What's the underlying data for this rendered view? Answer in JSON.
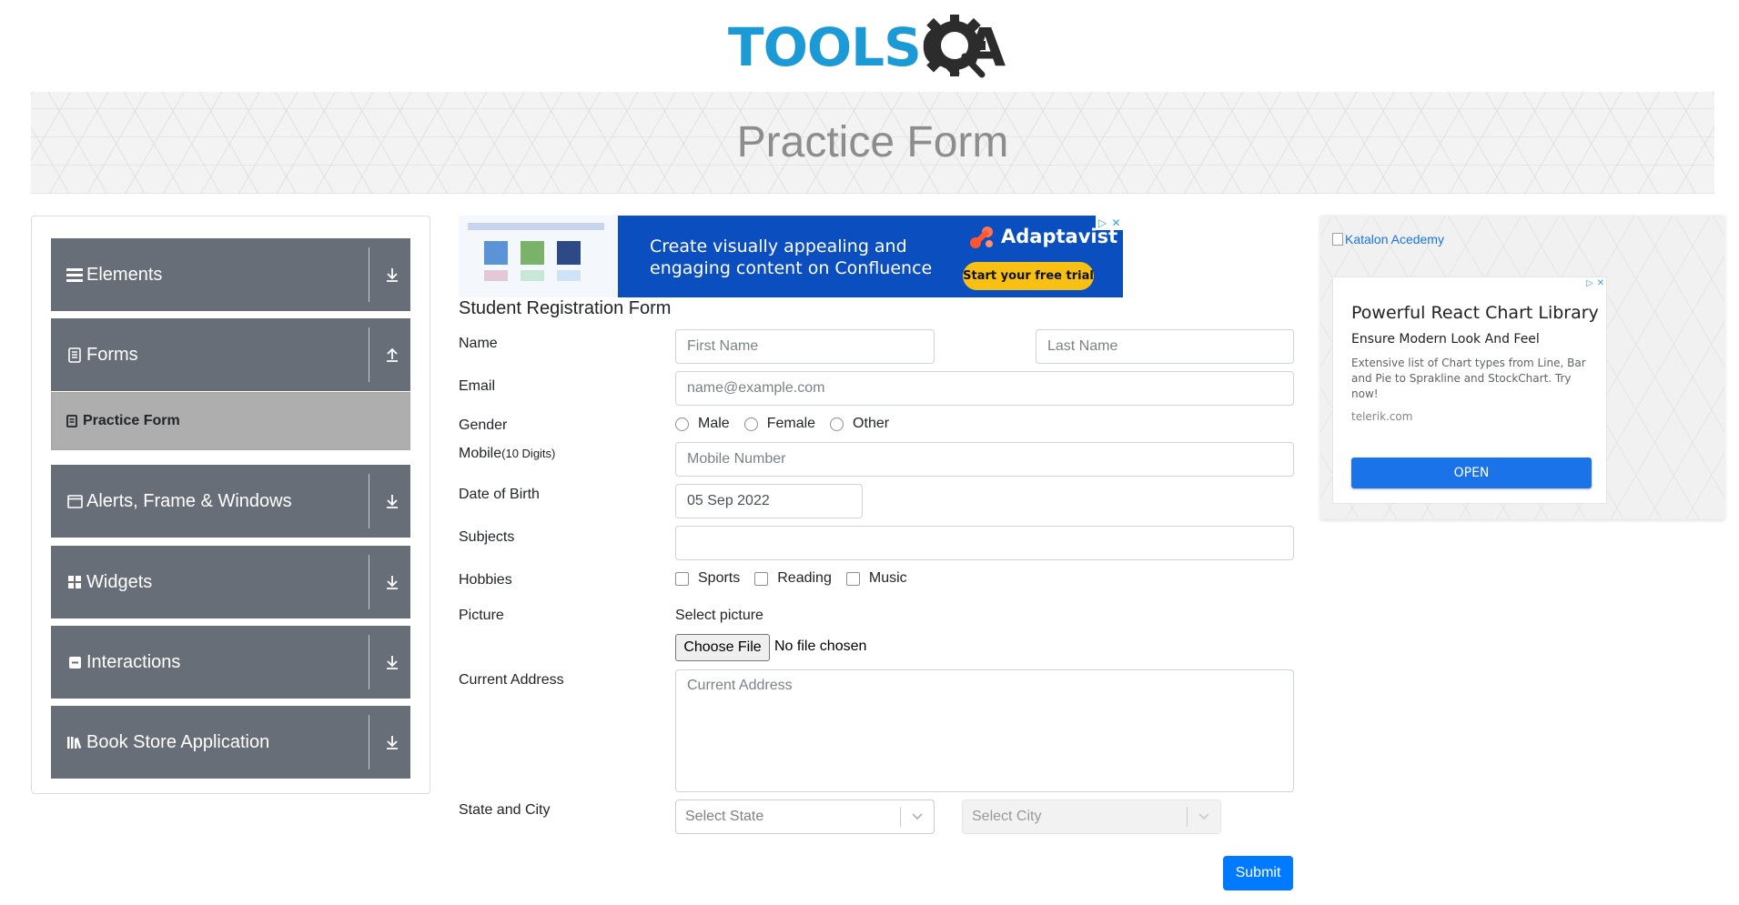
{
  "logo": {
    "text_main": "TOOLS",
    "text_accent": "QA",
    "colors": {
      "main": "#1b9ad6",
      "accent": "#2c2c2c"
    }
  },
  "page_title": "Practice Form",
  "sidebar": {
    "groups": [
      {
        "label": "Elements",
        "icon": "hamburger-icon",
        "arrow": "download-arrow-icon"
      },
      {
        "label": "Forms",
        "icon": "document-icon",
        "arrow": "upload-arrow-icon"
      },
      {
        "label": "Alerts, Frame & Windows",
        "icon": "window-icon",
        "arrow": "download-arrow-icon"
      },
      {
        "label": "Widgets",
        "icon": "grid-icon",
        "arrow": "download-arrow-icon"
      },
      {
        "label": "Interactions",
        "icon": "checkbox-icon",
        "arrow": "download-arrow-icon"
      },
      {
        "label": "Book Store Application",
        "icon": "books-icon",
        "arrow": "download-arrow-icon"
      }
    ],
    "active_item": {
      "label": "Practice Form",
      "icon": "form-icon"
    }
  },
  "ad_top": {
    "headline": "Create visually appealing and engaging content on Confluence",
    "brand": "Adaptavist",
    "cta": "Start your free trial",
    "colors": {
      "background": "#0a4ebf",
      "cta": "#f7c012",
      "brand_mark": "#ff5630"
    }
  },
  "form": {
    "title": "Student Registration Form",
    "name_label": "Name",
    "first_name_placeholder": "First Name",
    "last_name_placeholder": "Last Name",
    "email_label": "Email",
    "email_placeholder": "name@example.com",
    "gender_label": "Gender",
    "gender_options": [
      "Male",
      "Female",
      "Other"
    ],
    "mobile_label": "Mobile",
    "mobile_hint": "(10 Digits)",
    "mobile_placeholder": "Mobile Number",
    "dob_label": "Date of Birth",
    "dob_value": "05 Sep 2022",
    "subjects_label": "Subjects",
    "hobbies_label": "Hobbies",
    "hobbies_options": [
      "Sports",
      "Reading",
      "Music"
    ],
    "picture_label": "Picture",
    "select_picture": "Select picture",
    "choose_file": "Choose File",
    "file_status": "No file chosen",
    "address_label": "Current Address",
    "address_placeholder": "Current Address",
    "state_city_label": "State and City",
    "state_placeholder": "Select State",
    "city_placeholder": "Select City",
    "submit": "Submit",
    "colors": {
      "submit": "#007bff"
    }
  },
  "ad_right": {
    "image_alt": "Katalon Acedemy",
    "title": "Powerful React Chart Library",
    "subtitle": "Ensure Modern Look And Feel",
    "description": "Extensive list of Chart types from Line, Bar and Pie to Sprakline and StockChart. Try now!",
    "url": "telerik.com",
    "button": "OPEN",
    "colors": {
      "button": "#1a73e8"
    }
  }
}
